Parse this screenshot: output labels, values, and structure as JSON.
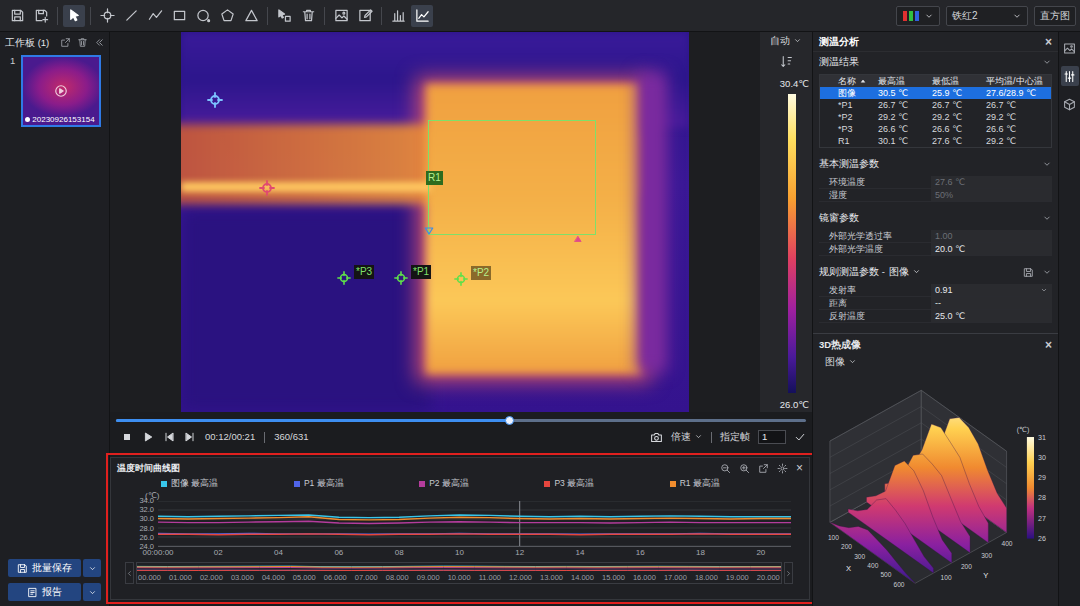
{
  "toolbar": {
    "tools": [
      {
        "kind": "save",
        "selected": false
      },
      {
        "kind": "saveas",
        "selected": false
      },
      {
        "kind": "pointer",
        "selected": true
      },
      {
        "kind": "point",
        "selected": false
      },
      {
        "kind": "line",
        "selected": false
      },
      {
        "kind": "polyline",
        "selected": false
      },
      {
        "kind": "rect",
        "selected": false
      },
      {
        "kind": "ellipse",
        "selected": false
      },
      {
        "kind": "polygon",
        "selected": false
      },
      {
        "kind": "triangle",
        "selected": false
      },
      {
        "kind": "pick",
        "selected": false
      },
      {
        "kind": "trash",
        "selected": false
      },
      {
        "kind": "image",
        "selected": false
      },
      {
        "kind": "edit",
        "selected": false
      },
      {
        "kind": "bars",
        "selected": false
      },
      {
        "kind": "curve",
        "selected": true
      }
    ],
    "palette": "铁红2",
    "histogram": "直方图"
  },
  "workboard": {
    "title": "工作板 (1)",
    "items": [
      {
        "index": "1",
        "label": "20230926153154",
        "selected": true
      }
    ],
    "buttons": [
      {
        "label": "批量保存",
        "kind": "save"
      },
      {
        "label": "报告",
        "kind": "report"
      }
    ]
  },
  "viewer": {
    "markers": [
      {
        "label": "R1",
        "kind": "region",
        "selected": false
      },
      {
        "label": "*P3",
        "kind": "point",
        "selected": false
      },
      {
        "label": "*P1",
        "kind": "point",
        "selected": false
      },
      {
        "label": "*P2",
        "kind": "point",
        "selected": true
      }
    ],
    "scale": {
      "mode": "自动",
      "max": "30.4℃",
      "min": "26.0℃"
    }
  },
  "playback": {
    "level": 0.57,
    "time": "00:12/00:21",
    "frame": "360/631",
    "speed": "倍速",
    "goto_label": "指定帧",
    "goto_value": "1"
  },
  "chart": {
    "title": "温度时间曲线图",
    "close": "×",
    "y_unit": "(℃)",
    "y_ticks": [
      "34.0",
      "32.0",
      "30.0",
      "28.0",
      "26.0",
      "24.0"
    ],
    "x_ticks": [
      {
        "label": "00:00:00",
        "t": 0
      },
      {
        "label": "02",
        "t": 2
      },
      {
        "label": "04",
        "t": 4
      },
      {
        "label": "06",
        "t": 6
      },
      {
        "label": "08",
        "t": 8
      },
      {
        "label": "10",
        "t": 10
      },
      {
        "label": "12",
        "t": 12
      },
      {
        "label": "14",
        "t": 14
      },
      {
        "label": "16",
        "t": 16
      },
      {
        "label": "18",
        "t": 18
      },
      {
        "label": "20",
        "t": 20
      }
    ],
    "cursor_t": 12,
    "navigator_ticks": [
      "00.000",
      "01.000",
      "02.000",
      "03.000",
      "04.000",
      "05.000",
      "06.000",
      "07.000",
      "08.000",
      "09.000",
      "10.000",
      "11.000",
      "12.000",
      "13.000",
      "14.000",
      "15.000",
      "16.000",
      "17.000",
      "18.000",
      "19.000",
      "20.000"
    ],
    "series": [
      {
        "label": "图像 最高温",
        "color": "#38c6ea",
        "values": [
          30.6,
          30.5,
          30.6,
          30.7,
          30.8,
          30.9,
          30.4,
          30.3,
          30.4,
          30.7,
          30.9,
          30.8,
          30.6,
          30.5,
          30.6,
          30.5,
          30.6,
          30.7,
          30.6,
          30.5,
          30.5,
          30.5
        ]
      },
      {
        "label": "P1 最高温",
        "color": "#4f64e8",
        "values": [
          26.8,
          26.7,
          26.7,
          26.8,
          26.7,
          26.7,
          26.7,
          26.6,
          26.7,
          26.7,
          26.8,
          26.7,
          26.7,
          26.7,
          26.6,
          26.7,
          26.7,
          26.7,
          26.8,
          26.7,
          26.7,
          26.7
        ]
      },
      {
        "label": "P2 最高温",
        "color": "#b43c9c",
        "values": [
          29.3,
          29.2,
          29.2,
          29.3,
          29.4,
          29.5,
          29.1,
          29.0,
          29.1,
          29.3,
          29.4,
          29.3,
          29.2,
          29.2,
          29.2,
          29.1,
          29.2,
          29.3,
          29.2,
          29.2,
          29.2,
          29.2
        ]
      },
      {
        "label": "P3 最高温",
        "color": "#e5463e",
        "values": [
          26.6,
          26.6,
          26.5,
          26.6,
          26.6,
          26.7,
          26.6,
          26.5,
          26.6,
          26.6,
          26.7,
          26.6,
          26.6,
          26.6,
          26.5,
          26.6,
          26.6,
          26.6,
          26.7,
          26.6,
          26.6,
          26.6
        ]
      },
      {
        "label": "R1 最高温",
        "color": "#f08c2e",
        "values": [
          30.1,
          30.0,
          30.1,
          30.2,
          30.3,
          30.5,
          29.9,
          29.8,
          29.9,
          30.2,
          30.4,
          30.3,
          30.1,
          30.0,
          30.1,
          30.0,
          30.1,
          30.2,
          30.1,
          30.0,
          30.1,
          30.1
        ]
      }
    ]
  },
  "analysis": {
    "title": "测温分析",
    "close": "×",
    "results": {
      "title": "测温结果",
      "columns": [
        "名称",
        "最高温",
        "最低温",
        "平均温/中心温"
      ],
      "rows": [
        {
          "cells": [
            "图像",
            "30.5 ℃",
            "25.9 ℃",
            "27.6/28.9 ℃"
          ],
          "selected": true
        },
        {
          "cells": [
            "*P1",
            "26.7 ℃",
            "26.7 ℃",
            "26.7 ℃"
          ],
          "selected": false
        },
        {
          "cells": [
            "*P2",
            "29.2 ℃",
            "29.2 ℃",
            "29.2 ℃"
          ],
          "selected": false
        },
        {
          "cells": [
            "*P3",
            "26.6 ℃",
            "26.6 ℃",
            "26.6 ℃"
          ],
          "selected": false
        },
        {
          "cells": [
            "R1",
            "30.1 ℃",
            "27.6 ℃",
            "29.2 ℃"
          ],
          "selected": false
        }
      ]
    },
    "sections": [
      {
        "title": "基本测温参数",
        "params": [
          {
            "label": "环境温度",
            "value": "27.6 ℃",
            "disabled": true,
            "kind": "field"
          },
          {
            "label": "湿度",
            "value": "50%",
            "disabled": true,
            "kind": "field"
          }
        ]
      },
      {
        "title": "镜窗参数",
        "params": [
          {
            "label": "外部光学透过率",
            "value": "1.00",
            "disabled": true,
            "kind": "field"
          },
          {
            "label": "外部光学温度",
            "value": "20.0 ℃",
            "disabled": false,
            "kind": "field"
          }
        ]
      },
      {
        "title": "规则测温参数 -",
        "source": "图像",
        "params": [
          {
            "label": "发射率",
            "value": "0.91",
            "disabled": false,
            "kind": "select"
          },
          {
            "label": "距离",
            "value": "--",
            "disabled": false,
            "kind": "field"
          },
          {
            "label": "反射温度",
            "value": "25.0 ℃",
            "disabled": false,
            "kind": "field"
          }
        ]
      }
    ]
  },
  "view3d": {
    "title": "3D热成像",
    "close": "×",
    "source": "图像",
    "unit": "(℃)",
    "legend_ticks": [
      "31",
      "30",
      "29",
      "28",
      "27",
      "26"
    ],
    "x_label": "X",
    "y_label": "Y",
    "x_ticks": [
      "100",
      "200",
      "300",
      "400",
      "500",
      "600"
    ],
    "y_ticks": [
      "100",
      "200",
      "300",
      "400"
    ],
    "surface": [
      [
        27.0,
        27.5,
        28.5,
        30.5,
        31.0,
        30.8,
        30.2,
        29.0,
        28.0,
        27.5
      ],
      [
        26.8,
        27.4,
        28.8,
        30.8,
        31.0,
        30.5,
        30.0,
        28.8,
        27.8,
        27.2
      ],
      [
        26.5,
        27.0,
        28.0,
        29.5,
        30.0,
        29.8,
        29.5,
        28.5,
        27.5,
        27.0
      ],
      [
        26.3,
        26.8,
        27.5,
        29.5,
        30.2,
        30.0,
        29.2,
        28.0,
        27.0,
        26.6
      ],
      [
        26.2,
        26.5,
        27.0,
        28.0,
        28.5,
        28.2,
        27.8,
        27.2,
        26.6,
        26.3
      ],
      [
        26.0,
        26.2,
        26.5,
        27.0,
        27.2,
        27.0,
        26.8,
        26.5,
        26.2,
        26.0
      ]
    ]
  },
  "side_tabs": [
    {
      "kind": "image",
      "selected": false
    },
    {
      "kind": "sliders",
      "selected": true
    },
    {
      "kind": "cube",
      "selected": false
    }
  ]
}
